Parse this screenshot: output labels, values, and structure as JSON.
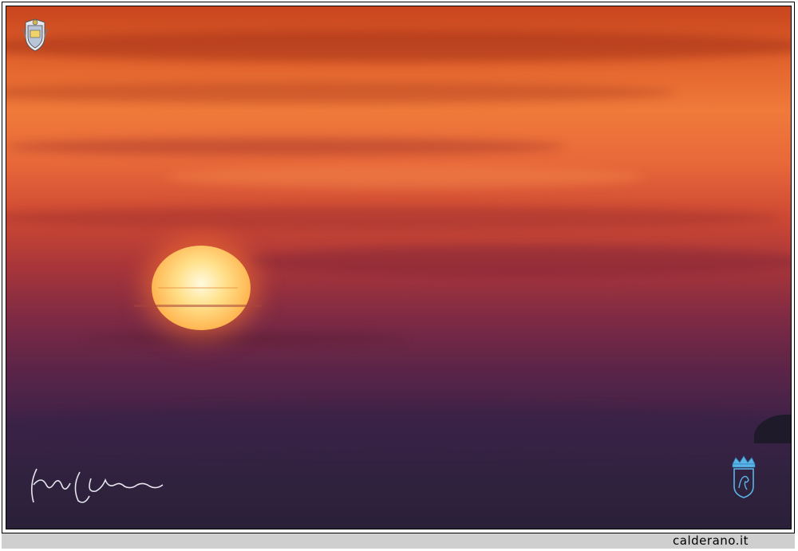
{
  "footer": {
    "site_label": "calderano.it"
  },
  "photo": {
    "subject": "sun-setting-over-sea",
    "colors": {
      "sky_top": "#c8441e",
      "sky_mid": "#ef7a3a",
      "horizon": "#7d2a44",
      "sea": "#2a2038",
      "sun_core": "#fffbe0"
    }
  },
  "overlays": {
    "top_crest_icon": "coat-of-arms-icon",
    "bottom_crest_icon": "lion-crest-icon",
    "signature_icon": "handwritten-signature-icon"
  }
}
